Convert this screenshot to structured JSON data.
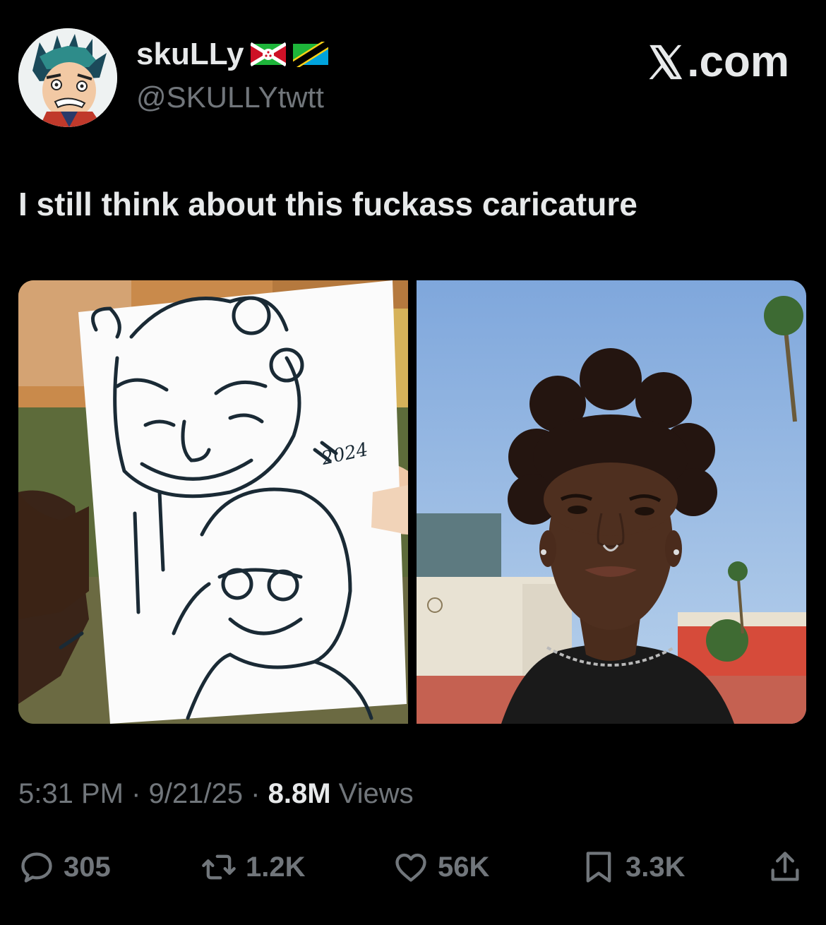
{
  "author": {
    "display_name": "skuLLy",
    "handle": "@SKULLYtwtt",
    "avatar_icon": "anime-avatar",
    "flags": [
      "flag-burundi-icon",
      "flag-tanzania-icon"
    ]
  },
  "brand": {
    "label": ".com",
    "icon": "x-logo-icon"
  },
  "tweet": {
    "text": "I still think about this fuckass caricature",
    "media": [
      {
        "name": "caricature-drawing-photo",
        "drawing_text": "2024"
      },
      {
        "name": "selfie-photo"
      }
    ]
  },
  "meta": {
    "time": "5:31 PM",
    "date": "9/21/25",
    "views_count": "8.8M",
    "views_label": "Views",
    "separator": "·"
  },
  "actions": {
    "replies": "305",
    "reposts": "1.2K",
    "likes": "56K",
    "bookmarks": "3.3K"
  },
  "colors": {
    "background": "#000000",
    "text_primary": "#e7e9ea",
    "text_secondary": "#71767b"
  }
}
